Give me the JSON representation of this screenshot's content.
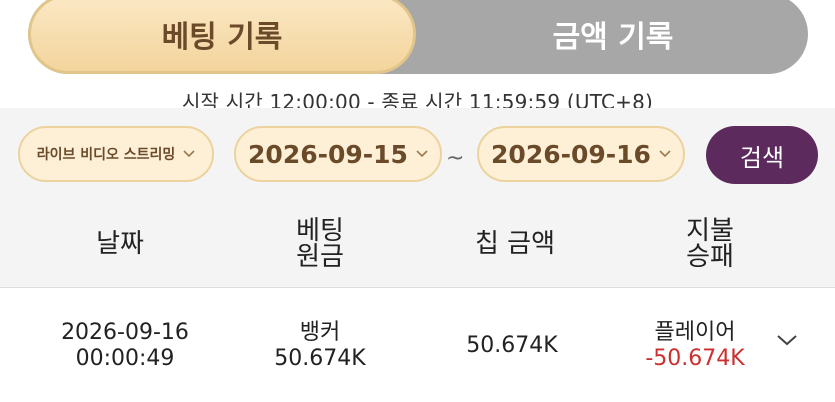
{
  "tabs": {
    "bet_record": "베팅 기록",
    "amount_record": "금액 기록"
  },
  "time_range": "시작 시간 12:00:00 - 종료 시간 11:59:59 (UTC+8)",
  "filters": {
    "source": "라이브 비디오 스트리밍",
    "start_date": "2026-09-15",
    "separator": "~",
    "end_date": "2026-09-16",
    "search_label": "검색"
  },
  "table": {
    "headers": {
      "date": "날짜",
      "bet_line1": "베팅",
      "bet_line2": "원금",
      "chip": "칩 금액",
      "result_line1": "지불",
      "result_line2": "승패"
    },
    "rows": [
      {
        "date": "2026-09-16",
        "time": "00:00:49",
        "bet_side": "뱅커",
        "bet_amount": "50.674K",
        "chip": "50.674K",
        "result_side": "플레이어",
        "result_amount": "-50.674K"
      }
    ]
  },
  "icons": {
    "dropdown": "chevron-down-icon",
    "expand": "chevron-down-icon"
  },
  "colors": {
    "accent_gold": "#f3d49c",
    "accent_purple": "#5d2a5e",
    "negative": "#cc2f2f"
  }
}
